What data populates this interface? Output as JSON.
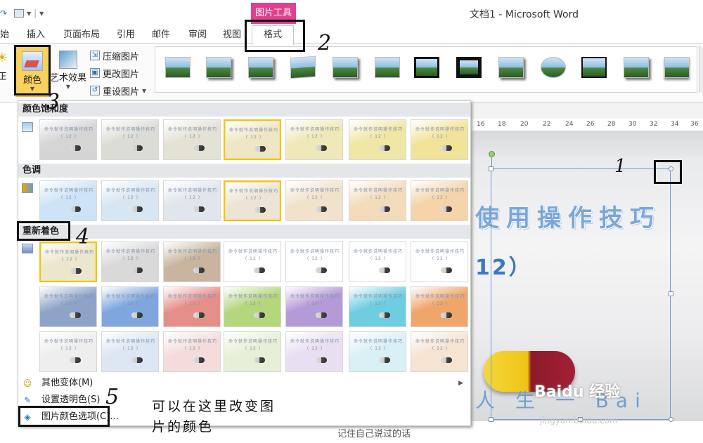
{
  "window": {
    "title": "文档1 - Microsoft Word",
    "context_tab_label": "图片工具"
  },
  "tabs": [
    {
      "label": "始"
    },
    {
      "label": "插入"
    },
    {
      "label": "页面布局"
    },
    {
      "label": "引用"
    },
    {
      "label": "邮件"
    },
    {
      "label": "审阅"
    },
    {
      "label": "视图"
    },
    {
      "label": "格式",
      "active": true
    }
  ],
  "ribbon": {
    "partial_label": "正",
    "color_label": "颜色",
    "art_effect_label": "艺术效果",
    "small_buttons": [
      "压缩图片",
      "更改图片",
      "重设图片"
    ]
  },
  "color_panel": {
    "saturation_header": "颜色饱和度",
    "tone_header": "色调",
    "recolor_header": "重新着色",
    "saturation_swatches": [
      {
        "bg": "#d5d5d5"
      },
      {
        "bg": "#dcdcd6"
      },
      {
        "bg": "#e4e2d4"
      },
      {
        "bg": "#ede7c4",
        "selected": true
      },
      {
        "bg": "#efe8b8"
      },
      {
        "bg": "#f0e6a6"
      },
      {
        "bg": "#f2e39a"
      }
    ],
    "tone_swatches": [
      {
        "bg": "#cde3f6"
      },
      {
        "bg": "#d8e6f2"
      },
      {
        "bg": "#e1e6ec"
      },
      {
        "bg": "#ece5d6",
        "selected": true
      },
      {
        "bg": "#f1e2cc"
      },
      {
        "bg": "#f3dcbc"
      },
      {
        "bg": "#f4d4a8"
      }
    ],
    "recolor_rows": [
      [
        {
          "bg": "#ece7cc",
          "selected": true
        },
        {
          "bg": "#d9d9d9"
        },
        {
          "bg": "#c9b59f"
        },
        {
          "bg": "#ffffff"
        },
        {
          "bg": "#ffffff"
        },
        {
          "bg": "#ffffff"
        },
        {
          "bg": "#ffffff"
        }
      ],
      [
        {
          "bg": "#8ea3c8"
        },
        {
          "bg": "#7fa7de"
        },
        {
          "bg": "#e58f8a"
        },
        {
          "bg": "#b4d67c"
        },
        {
          "bg": "#b49ad6"
        },
        {
          "bg": "#6fcde0"
        },
        {
          "bg": "#f0a56b"
        }
      ],
      [
        {
          "bg": "#eeeeee"
        },
        {
          "bg": "#dde6f3"
        },
        {
          "bg": "#f4dcdc"
        },
        {
          "bg": "#e6f0d6"
        },
        {
          "bg": "#e8e0f2"
        },
        {
          "bg": "#d9f0f4"
        },
        {
          "bg": "#f7e3d2"
        }
      ]
    ],
    "swatch_text": "命令就作说明操作技巧",
    "swatch_sub": "( 12 )",
    "menu_items": [
      {
        "label": "其他变体(M)",
        "icon": "palette-icon",
        "has_submenu": true
      },
      {
        "label": "设置透明色(S)",
        "icon": "pen-icon",
        "has_submenu": false
      },
      {
        "label": "图片颜色选项(C)...",
        "icon": "picture-color-icon",
        "has_submenu": false
      }
    ]
  },
  "document": {
    "picture_title_line1": "使用操作技巧",
    "picture_title_line2": "12）",
    "picture_footer": "人 生 一 Bai",
    "caption": "记住自己说过的话",
    "ruler_ticks": [
      "16",
      "18",
      "20",
      "22",
      "24",
      "26",
      "28",
      "30",
      "32",
      "34",
      "36"
    ]
  },
  "annotations": {
    "numbers": [
      "2",
      "3",
      "4",
      "5",
      "1"
    ],
    "note_line1": "可以在这里改变图",
    "note_line2": "片的颜色"
  },
  "watermark": {
    "text": "Baidu 经验",
    "sub": "jingyan.baidu.com"
  }
}
